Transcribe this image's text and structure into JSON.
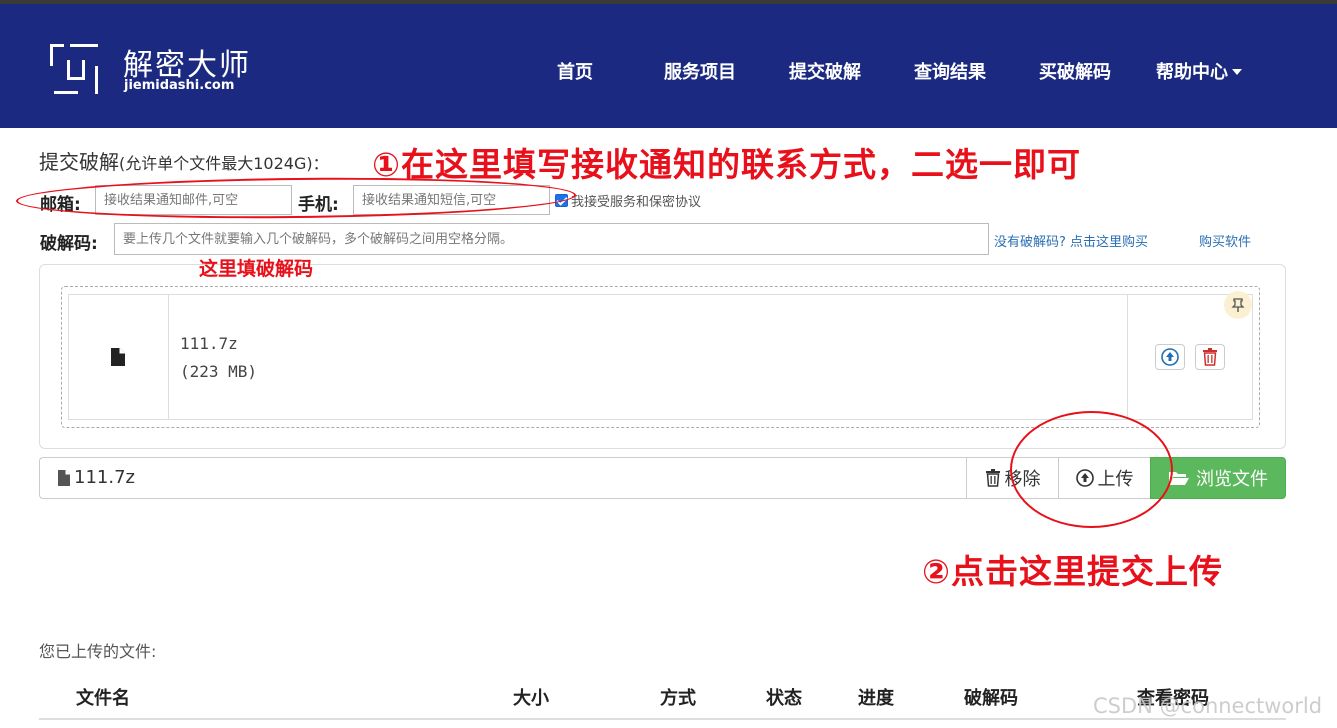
{
  "brand": {
    "title": "解密大师",
    "domain": "jiemidashi.com"
  },
  "nav": {
    "items": [
      {
        "label": "首页"
      },
      {
        "label": "服务项目"
      },
      {
        "label": "提交破解"
      },
      {
        "label": "查询结果"
      },
      {
        "label": "买破解码"
      },
      {
        "label": "帮助中心"
      }
    ]
  },
  "form": {
    "title": "提交破解",
    "title_note": "(允许单个文件最大1024G)：",
    "email_label": "邮箱:",
    "email_placeholder": "接收结果通知邮件,可空",
    "phone_label": "手机:",
    "phone_placeholder": "接收结果通知短信,可空",
    "agree_text": "我接受服务和保密协议",
    "code_label": "破解码:",
    "code_placeholder": "要上传几个文件就要输入几个破解码，多个破解码之间用空格分隔。",
    "no_code_link": "没有破解码? 点击这里购买",
    "buy_software_link": "购买软件"
  },
  "annotations": {
    "contact": "①在这里填写接收通知的联系方式，二选一即可",
    "code": "这里填破解码",
    "upload": "②点击这里提交上传"
  },
  "file": {
    "name": "111.7z",
    "size": "(223 MB)"
  },
  "caption": {
    "filename": "111.7z"
  },
  "buttons": {
    "remove": "移除",
    "upload": "上传",
    "browse": "浏览文件"
  },
  "uploaded": {
    "title": "您已上传的文件:",
    "columns": [
      "文件名",
      "大小",
      "方式",
      "状态",
      "进度",
      "破解码",
      "查看密码"
    ]
  },
  "watermark": "CSDN @connectworld",
  "colors": {
    "navbar": "#1b2a80",
    "annotation": "#e8101a",
    "browse_button": "#5cb85c",
    "link": "#2a6fb5"
  },
  "icons": [
    "file-icon",
    "upload-circle-icon",
    "trash-icon",
    "pin-icon",
    "folder-open-icon",
    "caret-down-icon"
  ]
}
